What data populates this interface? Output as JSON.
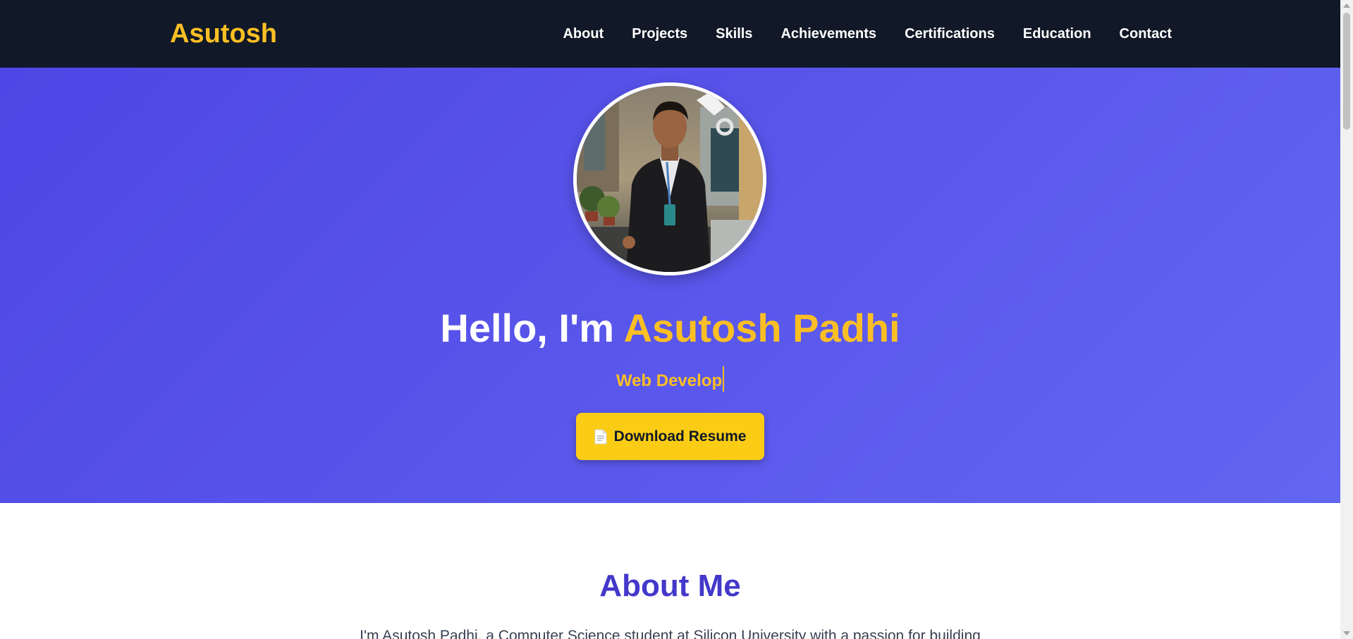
{
  "nav": {
    "brand": "Asutosh",
    "links": [
      "About",
      "Projects",
      "Skills",
      "Achievements",
      "Certifications",
      "Education",
      "Contact"
    ]
  },
  "hero": {
    "greeting": "Hello, I'm ",
    "name": "Asutosh Padhi",
    "typing_text": "Web Develop",
    "resume_button": {
      "icon": "document-icon",
      "label": "Download Resume"
    },
    "avatar_alt": "profile-photo"
  },
  "about": {
    "title": "About Me",
    "text": "I'm Asutosh Padhi, a Computer Science student at Silicon University with a passion for building"
  },
  "colors": {
    "nav_bg": "#111827",
    "hero_bg": "#4f46e5",
    "accent": "#fbbf24",
    "button": "#facc15",
    "about_title": "#4338ca"
  }
}
